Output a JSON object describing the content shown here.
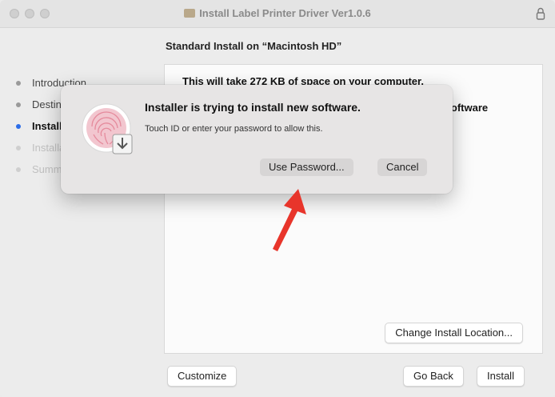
{
  "window": {
    "title": "Install Label Printer Driver Ver1.0.6"
  },
  "heading": "Standard Install on “Macintosh HD”",
  "sidebar": {
    "items": [
      {
        "label": "Introduction",
        "state": "done"
      },
      {
        "label": "Destination Select",
        "state": "done"
      },
      {
        "label": "Installation Type",
        "state": "active"
      },
      {
        "label": "Installation",
        "state": "pending"
      },
      {
        "label": "Summary",
        "state": "pending"
      }
    ]
  },
  "content": {
    "line1": "This will take 272 KB of space on your computer.",
    "line2": "Click Install to perform a standard installation of this software"
  },
  "buttons": {
    "change_location": "Change Install Location...",
    "customize": "Customize",
    "go_back": "Go Back",
    "install": "Install"
  },
  "dialog": {
    "title": "Installer is trying to install new software.",
    "subtitle": "Touch ID or enter your password to allow this.",
    "use_password": "Use Password...",
    "cancel": "Cancel",
    "icon": "fingerprint-icon"
  },
  "annotation": {
    "arrow_color": "#e8352b"
  }
}
